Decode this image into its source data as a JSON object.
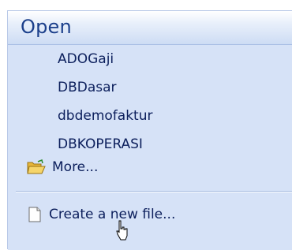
{
  "panel": {
    "title": "Open",
    "recent_files": [
      {
        "label": "ADOGaji"
      },
      {
        "label": "DBDasar"
      },
      {
        "label": "dbdemofaktur"
      },
      {
        "label": "DBKOPERASI"
      }
    ],
    "more": {
      "label": "More...",
      "icon": "folder-open-icon"
    },
    "create": {
      "label": "Create a new file...",
      "icon": "document-icon"
    }
  },
  "colors": {
    "panel_bg": "#d6e2f7",
    "title_text": "#1b3f8b",
    "link_text": "#0c1f5c"
  }
}
